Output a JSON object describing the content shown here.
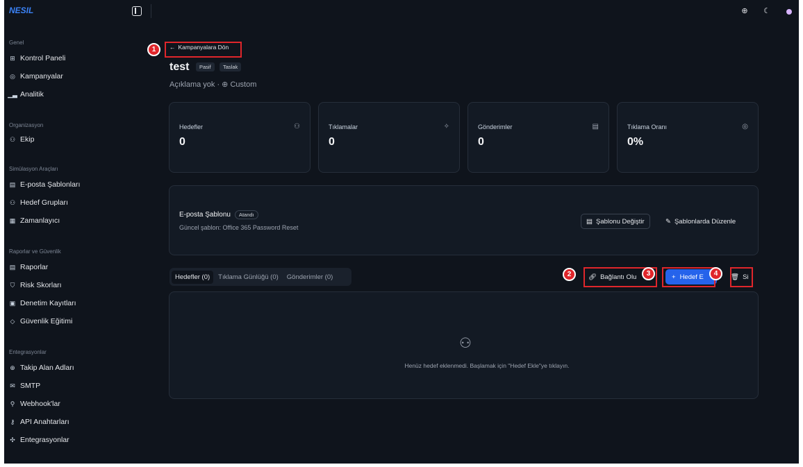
{
  "brand": "NESIL",
  "sidebar": {
    "sections": [
      {
        "title": "Genel",
        "items": [
          {
            "label": "Kontrol Paneli",
            "icon": "dashboard-icon"
          },
          {
            "label": "Kampanyalar",
            "icon": "target-icon"
          },
          {
            "label": "Analitik",
            "icon": "chart-icon"
          }
        ]
      },
      {
        "title": "Organizasyon",
        "items": [
          {
            "label": "Ekip",
            "icon": "team-icon"
          }
        ]
      },
      {
        "title": "Simülasyon Araçları",
        "items": [
          {
            "label": "E-posta Şablonları",
            "icon": "file-icon"
          },
          {
            "label": "Hedef Grupları",
            "icon": "users-icon"
          },
          {
            "label": "Zamanlayıcı",
            "icon": "calendar-icon"
          }
        ]
      },
      {
        "title": "Raporlar ve Güvenlik",
        "items": [
          {
            "label": "Raporlar",
            "icon": "report-icon"
          },
          {
            "label": "Risk Skorları",
            "icon": "shield-icon"
          },
          {
            "label": "Denetim Kayıtları",
            "icon": "audit-icon"
          },
          {
            "label": "Güvenlik Eğitimi",
            "icon": "graduation-icon"
          }
        ]
      },
      {
        "title": "Entegrasyonlar",
        "items": [
          {
            "label": "Takip Alan Adları",
            "icon": "globe-icon"
          },
          {
            "label": "SMTP",
            "icon": "mail-icon"
          },
          {
            "label": "Webhook'lar",
            "icon": "webhook-icon"
          },
          {
            "label": "API Anahtarları",
            "icon": "key-icon"
          },
          {
            "label": "Entegrasyonlar",
            "icon": "puzzle-icon"
          }
        ]
      }
    ]
  },
  "header": {
    "back_label": "Kampanyalara Dön"
  },
  "campaign": {
    "title": "test",
    "badges": [
      "Pasif",
      "Taslak"
    ],
    "description": "Açıklama yok · ⊕ Custom"
  },
  "stats": [
    {
      "label": "Hedefler",
      "value": "0",
      "icon": "users-icon"
    },
    {
      "label": "Tıklamalar",
      "value": "0",
      "icon": "cursor-click-icon"
    },
    {
      "label": "Gönderimler",
      "value": "0",
      "icon": "document-icon"
    },
    {
      "label": "Tıklama Oranı",
      "value": "0%",
      "icon": "target-icon"
    }
  ],
  "template": {
    "title": "E-posta Şablonu",
    "pill": "Atandı",
    "current": "Güncel şablon: Office 365 Password Reset",
    "change_label": "Şablonu Değiştir",
    "edit_label": "Şablonlarda Düzenle"
  },
  "tabs": [
    "Hedefler (0)",
    "Tıklama Günlüğü (0)",
    "Gönderimler (0)"
  ],
  "actions": {
    "link_label": "Bağlantı Olu",
    "add_label": "Hedef E",
    "delete_label": "Si"
  },
  "empty_text": "Henüz hedef eklenmedi. Başlamak için \"Hedef Ekle\"ye tıklayın.",
  "annotations": [
    "1",
    "2",
    "3",
    "4"
  ],
  "colors": {
    "background": "#0f141c",
    "card": "#131a24",
    "accent": "#2563eb",
    "annotation": "#e0262b",
    "brand": "#3b82f6"
  }
}
